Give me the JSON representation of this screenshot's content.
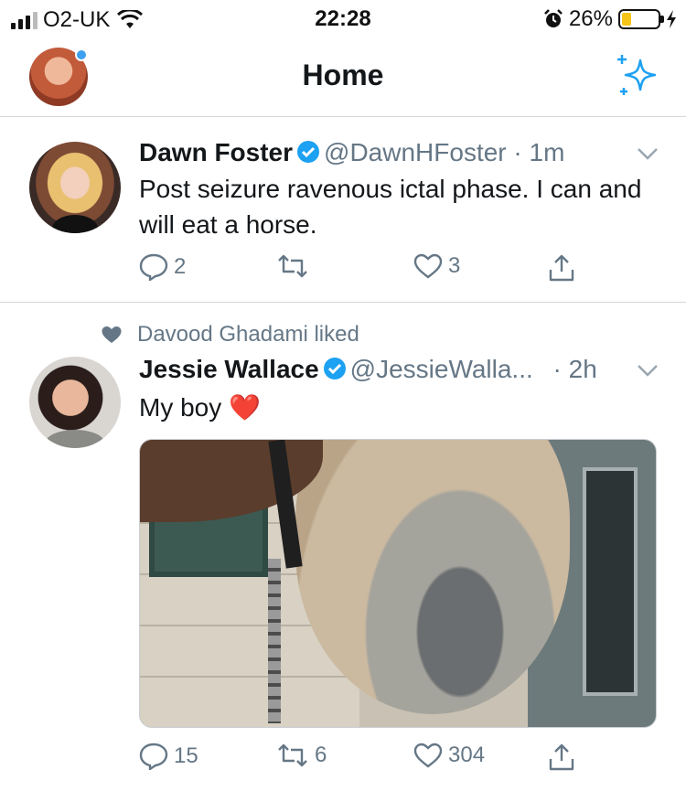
{
  "status_bar": {
    "carrier": "O2-UK",
    "time": "22:28",
    "battery_percent": "26%",
    "battery_level": 0.26,
    "icons": [
      "signal-icon",
      "wifi-icon",
      "alarm-icon",
      "battery-icon",
      "charging-icon"
    ]
  },
  "header": {
    "title": "Home",
    "icons": [
      "profile-avatar",
      "sparkle-icon"
    ]
  },
  "tweets": [
    {
      "name": "Dawn Foster",
      "handle": "@DawnHFoster",
      "time": " · 1m",
      "verified": true,
      "text": "Post seizure ravenous ictal phase. I can and will eat a horse.",
      "replies": "2",
      "retweets": "",
      "likes": "3"
    },
    {
      "social_context": "Davood Ghadami liked",
      "name": "Jessie Wallace",
      "handle": "@JessieWalla...",
      "time": " · 2h",
      "verified": true,
      "text": "My boy",
      "emoji": "❤️",
      "replies": "15",
      "retweets": "6",
      "likes": "304"
    }
  ],
  "colors": {
    "accent": "#1da1f2",
    "muted": "#657786",
    "verified": "#1da1f2",
    "battery_fill": "#f5c518",
    "emoji_heart": "#e0245e"
  }
}
